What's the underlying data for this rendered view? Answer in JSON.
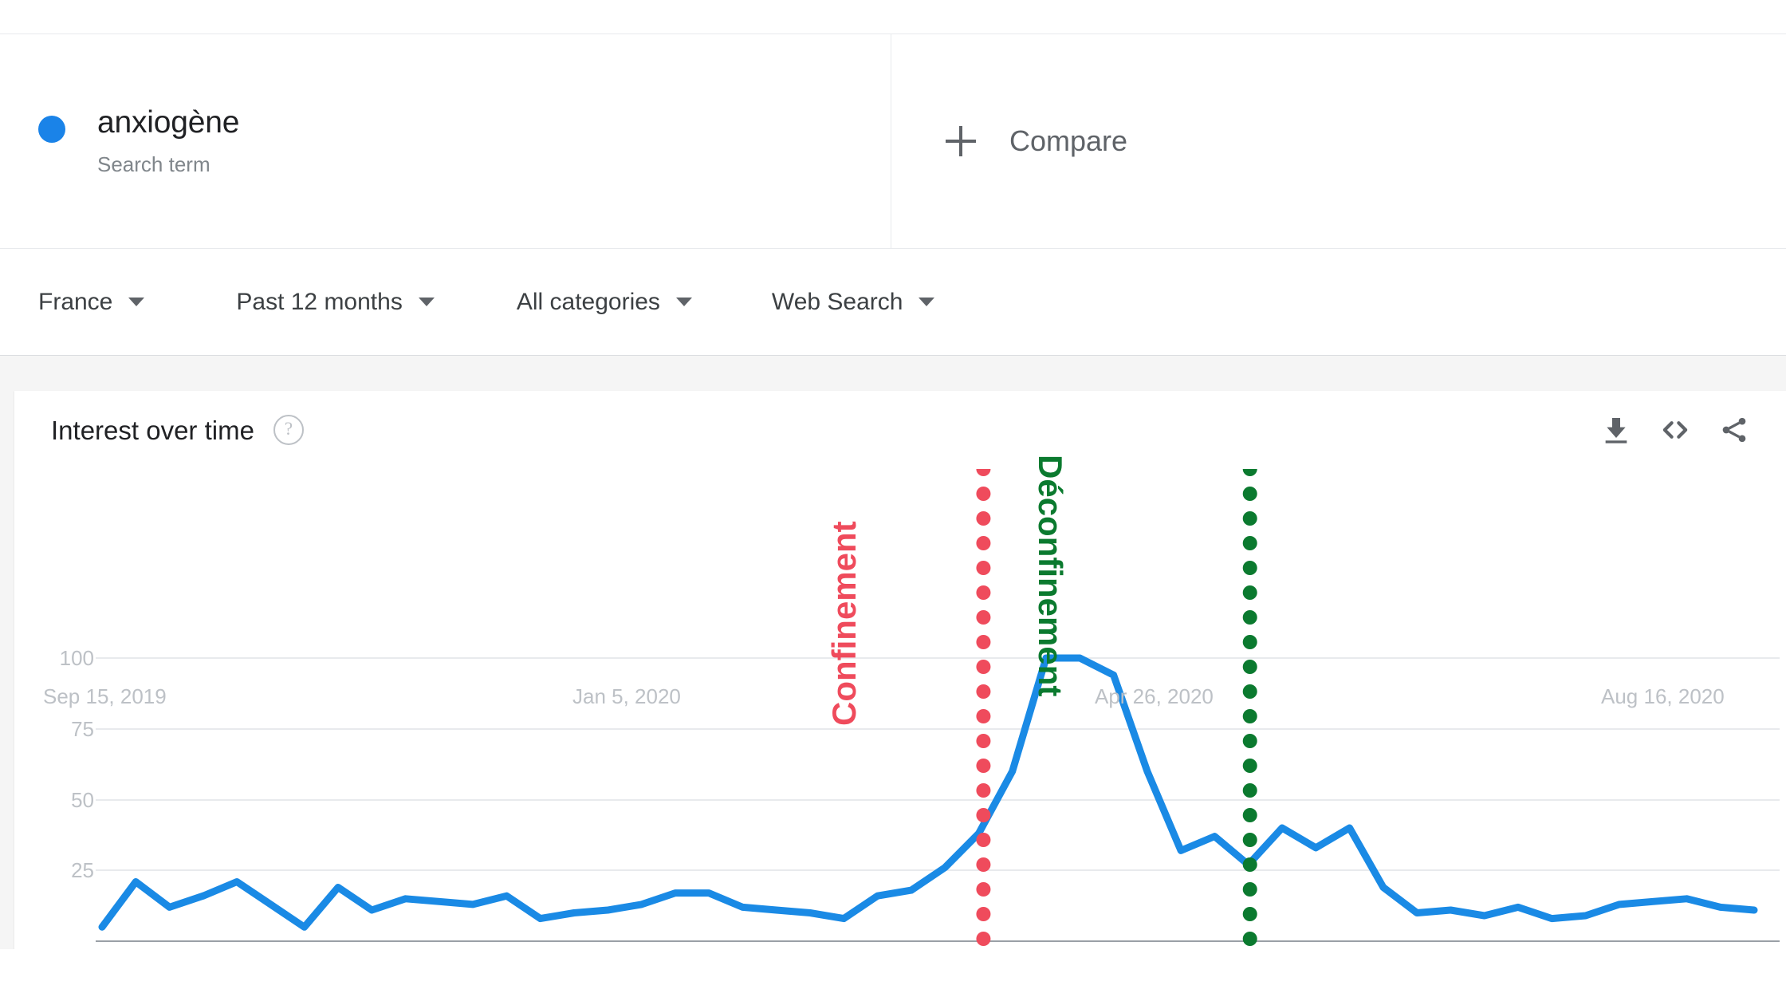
{
  "term": {
    "name": "anxiogène",
    "subtitle": "Search term",
    "dot_color": "#1a83e8"
  },
  "compare": {
    "label": "Compare",
    "icon": "plus-icon"
  },
  "filters": [
    {
      "label": "France"
    },
    {
      "label": "Past 12 months"
    },
    {
      "label": "All categories"
    },
    {
      "label": "Web Search"
    }
  ],
  "card": {
    "title": "Interest over time",
    "help_icon": "?",
    "actions": [
      {
        "name": "download-icon"
      },
      {
        "name": "embed-code-icon"
      },
      {
        "name": "share-icon"
      }
    ]
  },
  "chart_data": {
    "type": "line",
    "title": "Interest over time",
    "xlabel": "",
    "ylabel": "",
    "ylim": [
      0,
      108
    ],
    "yticks": [
      25,
      50,
      75,
      100
    ],
    "grid": true,
    "legend_position": "top-left",
    "line_color": "#1a8ae5",
    "series": [
      {
        "name": "anxiogène",
        "color": "#1a8ae5",
        "x": [
          "Sep 15, 2019",
          "Sep 22, 2019",
          "Sep 29, 2019",
          "Oct 6, 2019",
          "Oct 13, 2019",
          "Oct 20, 2019",
          "Oct 27, 2019",
          "Nov 3, 2019",
          "Nov 10, 2019",
          "Nov 17, 2019",
          "Nov 24, 2019",
          "Dec 1, 2019",
          "Dec 8, 2019",
          "Dec 15, 2019",
          "Dec 22, 2019",
          "Dec 29, 2019",
          "Jan 5, 2020",
          "Jan 12, 2020",
          "Jan 19, 2020",
          "Jan 26, 2020",
          "Feb 2, 2020",
          "Feb 9, 2020",
          "Feb 16, 2020",
          "Feb 23, 2020",
          "Mar 1, 2020",
          "Mar 8, 2020",
          "Mar 15, 2020",
          "Mar 22, 2020",
          "Mar 29, 2020",
          "Apr 5, 2020",
          "Apr 12, 2020",
          "Apr 19, 2020",
          "Apr 26, 2020",
          "May 3, 2020",
          "May 10, 2020",
          "May 17, 2020",
          "May 24, 2020",
          "May 31, 2020",
          "Jun 7, 2020",
          "Jun 14, 2020",
          "Jun 21, 2020",
          "Jun 28, 2020",
          "Jul 5, 2020",
          "Jul 12, 2020",
          "Jul 19, 2020",
          "Jul 26, 2020",
          "Aug 2, 2020",
          "Aug 9, 2020",
          "Aug 16, 2020",
          "Aug 23, 2020"
        ],
        "values": [
          5,
          21,
          12,
          16,
          21,
          13,
          5,
          19,
          11,
          15,
          14,
          13,
          16,
          8,
          10,
          11,
          13,
          17,
          17,
          12,
          11,
          10,
          8,
          16,
          18,
          26,
          38,
          60,
          100,
          100,
          94,
          60,
          32,
          37,
          27,
          40,
          33,
          40,
          19,
          10,
          11,
          9,
          12,
          8,
          9,
          13,
          14,
          15,
          12,
          11
        ]
      }
    ],
    "xticks": [
      "Sep 15, 2019",
      "Jan 5, 2020",
      "Apr 26, 2020",
      "Aug 16, 2020"
    ],
    "annotations": [
      {
        "label": "Confinement",
        "color": "#ef4b5c",
        "style": "dotted-vertical-line",
        "x_value": "Mar 17, 2020",
        "orientation": "rotate-ccw"
      },
      {
        "label": "Déconfinement",
        "color": "#0b7a2f",
        "style": "dotted-vertical-line",
        "x_value": "May 11, 2020",
        "orientation": "rotate-cw"
      }
    ]
  }
}
